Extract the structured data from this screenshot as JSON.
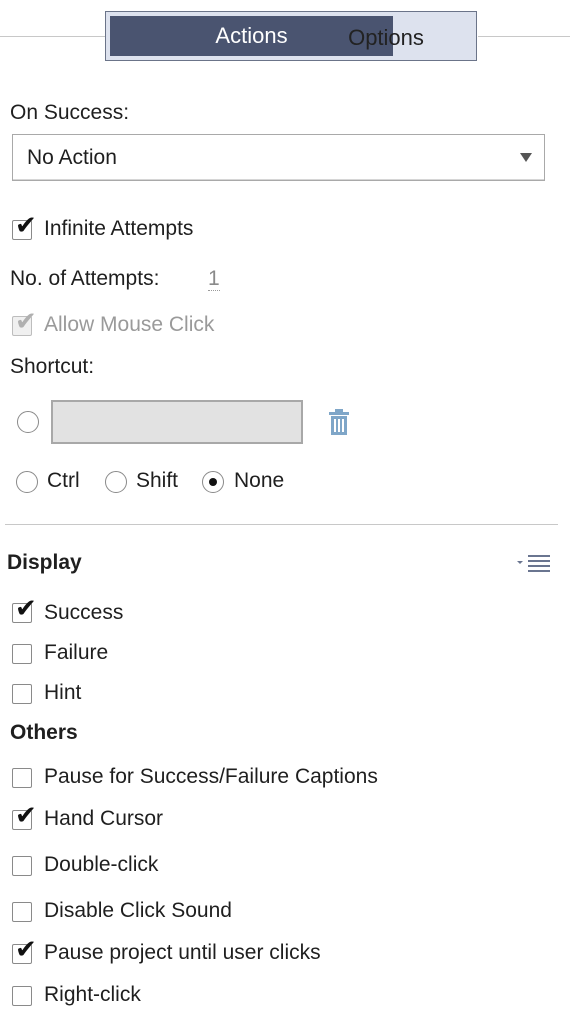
{
  "tabs": {
    "actions": "Actions",
    "options": "Options"
  },
  "on_success": {
    "label": "On Success:",
    "value": "No Action"
  },
  "infinite_attempts": {
    "label": "Infinite Attempts",
    "checked": true
  },
  "attempts": {
    "label": "No. of Attempts:",
    "value": "1"
  },
  "allow_mouse_click": {
    "label": "Allow Mouse Click",
    "checked": true,
    "disabled": true
  },
  "shortcut": {
    "label": "Shortcut:",
    "modifiers": [
      {
        "label": "Ctrl",
        "selected": false
      },
      {
        "label": "Shift",
        "selected": false
      },
      {
        "label": "None",
        "selected": true
      }
    ]
  },
  "display": {
    "title": "Display",
    "items": [
      {
        "label": "Success",
        "checked": true
      },
      {
        "label": "Failure",
        "checked": false
      },
      {
        "label": "Hint",
        "checked": false
      }
    ]
  },
  "others": {
    "title": "Others",
    "items": [
      {
        "label": "Pause for Success/Failure Captions",
        "checked": false
      },
      {
        "label": "Hand Cursor",
        "checked": true
      },
      {
        "label": "Double-click",
        "checked": false
      },
      {
        "label": "Disable Click Sound",
        "checked": false
      },
      {
        "label": "Pause project until user clicks",
        "checked": true
      },
      {
        "label": "Right-click",
        "checked": false
      }
    ]
  },
  "colors": {
    "tab_active": "#4a5470",
    "tab_bg": "#dde2ee",
    "trash_icon": "#7fa6c8"
  }
}
